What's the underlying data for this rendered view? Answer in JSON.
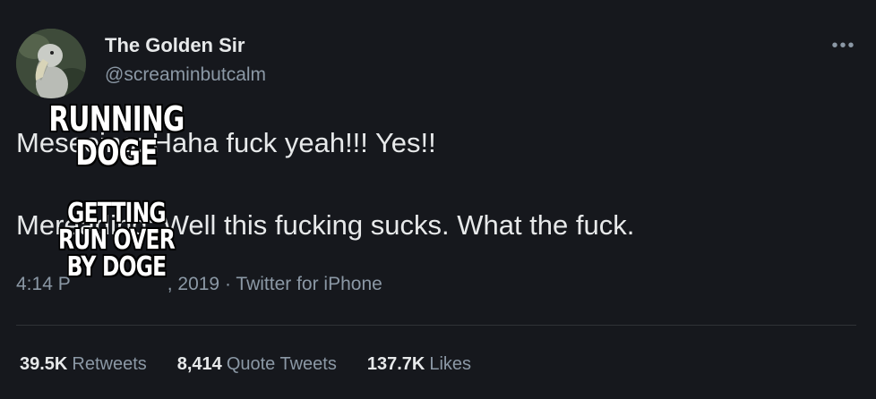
{
  "author": {
    "display_name": "The Golden Sir",
    "handle": "@screaminbutcalm",
    "avatar_icon": "shoebill-bird-avatar"
  },
  "more_icon": "more-options-icon",
  "tweet_lines": [
    {
      "prefix": "Me ",
      "obscured": "seeing",
      "rest": ": Haha fuck yeah!!! Yes!!"
    },
    {
      "prefix": "Me ",
      "obscured": "reading",
      "rest": ": Well this fucking sucks. What the fuck."
    }
  ],
  "meta": {
    "time_prefix": "4:14 P",
    "date_suffix": ", 2019",
    "separator": " · ",
    "source": "Twitter for iPhone"
  },
  "stats": [
    {
      "count": "39.5K",
      "label": "Retweets"
    },
    {
      "count": "8,414",
      "label": "Quote Tweets"
    },
    {
      "count": "137.7K",
      "label": "Likes"
    }
  ],
  "captions": {
    "top": [
      "RUNNING",
      "DOGE"
    ],
    "bottom": [
      "GETTING",
      "RUN OVER",
      "BY DOGE"
    ]
  },
  "colors": {
    "background": "#16181d",
    "primary_text": "#e7e9ea",
    "secondary_text": "#8b98a5",
    "divider": "#2f3336"
  }
}
